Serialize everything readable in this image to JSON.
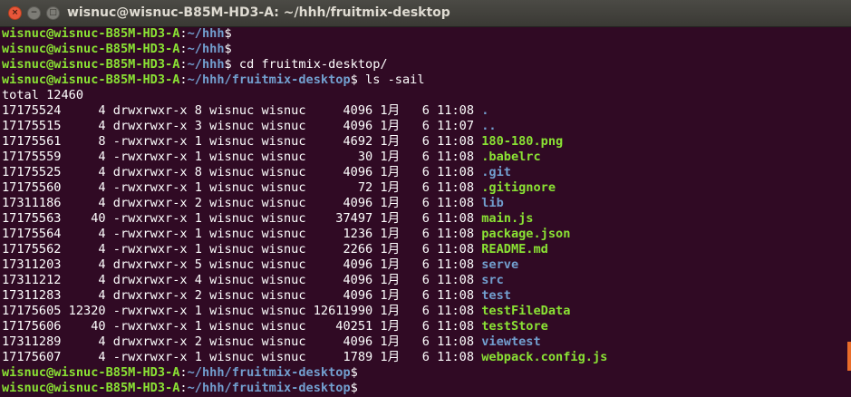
{
  "window": {
    "title": "wisnuc@wisnuc-B85M-HD3-A: ~/hhh/fruitmix-desktop",
    "close_glyph": "×",
    "minimize_glyph": "−",
    "maximize_glyph": "□"
  },
  "colors": {
    "background": "#300a24",
    "user_host": "#8ae234",
    "path": "#729fcf",
    "directory": "#729fcf",
    "executable": "#8ae234",
    "text": "#ffffff",
    "scroll_indicator": "#e96c2a"
  },
  "prompts": [
    {
      "user_host": "wisnuc@wisnuc-B85M-HD3-A",
      "path": "~/hhh",
      "symbol": "$",
      "command": ""
    },
    {
      "user_host": "wisnuc@wisnuc-B85M-HD3-A",
      "path": "~/hhh",
      "symbol": "$",
      "command": ""
    },
    {
      "user_host": "wisnuc@wisnuc-B85M-HD3-A",
      "path": "~/hhh",
      "symbol": "$",
      "command": " cd fruitmix-desktop/"
    },
    {
      "user_host": "wisnuc@wisnuc-B85M-HD3-A",
      "path": "~/hhh/fruitmix-desktop",
      "symbol": "$",
      "command": " ls -sail"
    }
  ],
  "total_line": "total 12460",
  "listing": [
    {
      "prefix": "17175524     4 drwxrwxr-x 8 wisnuc wisnuc     4096 1月   6 11:08 ",
      "name": ".",
      "type": "dir"
    },
    {
      "prefix": "17175515     4 drwxrwxr-x 3 wisnuc wisnuc     4096 1月   6 11:07 ",
      "name": "..",
      "type": "dir"
    },
    {
      "prefix": "17175561     8 -rwxrwxr-x 1 wisnuc wisnuc     4692 1月   6 11:08 ",
      "name": "180-180.png",
      "type": "exe"
    },
    {
      "prefix": "17175559     4 -rwxrwxr-x 1 wisnuc wisnuc       30 1月   6 11:08 ",
      "name": ".babelrc",
      "type": "exe"
    },
    {
      "prefix": "17175525     4 drwxrwxr-x 8 wisnuc wisnuc     4096 1月   6 11:08 ",
      "name": ".git",
      "type": "dir"
    },
    {
      "prefix": "17175560     4 -rwxrwxr-x 1 wisnuc wisnuc       72 1月   6 11:08 ",
      "name": ".gitignore",
      "type": "exe"
    },
    {
      "prefix": "17311186     4 drwxrwxr-x 2 wisnuc wisnuc     4096 1月   6 11:08 ",
      "name": "lib",
      "type": "dir"
    },
    {
      "prefix": "17175563    40 -rwxrwxr-x 1 wisnuc wisnuc    37497 1月   6 11:08 ",
      "name": "main.js",
      "type": "exe"
    },
    {
      "prefix": "17175564     4 -rwxrwxr-x 1 wisnuc wisnuc     1236 1月   6 11:08 ",
      "name": "package.json",
      "type": "exe"
    },
    {
      "prefix": "17175562     4 -rwxrwxr-x 1 wisnuc wisnuc     2266 1月   6 11:08 ",
      "name": "README.md",
      "type": "exe"
    },
    {
      "prefix": "17311203     4 drwxrwxr-x 5 wisnuc wisnuc     4096 1月   6 11:08 ",
      "name": "serve",
      "type": "dir"
    },
    {
      "prefix": "17311212     4 drwxrwxr-x 4 wisnuc wisnuc     4096 1月   6 11:08 ",
      "name": "src",
      "type": "dir"
    },
    {
      "prefix": "17311283     4 drwxrwxr-x 2 wisnuc wisnuc     4096 1月   6 11:08 ",
      "name": "test",
      "type": "dir"
    },
    {
      "prefix": "17175605 12320 -rwxrwxr-x 1 wisnuc wisnuc 12611990 1月   6 11:08 ",
      "name": "testFileData",
      "type": "exe"
    },
    {
      "prefix": "17175606    40 -rwxrwxr-x 1 wisnuc wisnuc    40251 1月   6 11:08 ",
      "name": "testStore",
      "type": "exe"
    },
    {
      "prefix": "17311289     4 drwxrwxr-x 2 wisnuc wisnuc     4096 1月   6 11:08 ",
      "name": "viewtest",
      "type": "dir"
    },
    {
      "prefix": "17175607     4 -rwxrwxr-x 1 wisnuc wisnuc     1789 1月   6 11:08 ",
      "name": "webpack.config.js",
      "type": "exe"
    }
  ],
  "trailing_prompts": [
    {
      "user_host": "wisnuc@wisnuc-B85M-HD3-A",
      "path": "~/hhh/fruitmix-desktop",
      "symbol": "$",
      "command": ""
    },
    {
      "user_host": "wisnuc@wisnuc-B85M-HD3-A",
      "path": "~/hhh/fruitmix-desktop",
      "symbol": "$",
      "command": ""
    }
  ]
}
